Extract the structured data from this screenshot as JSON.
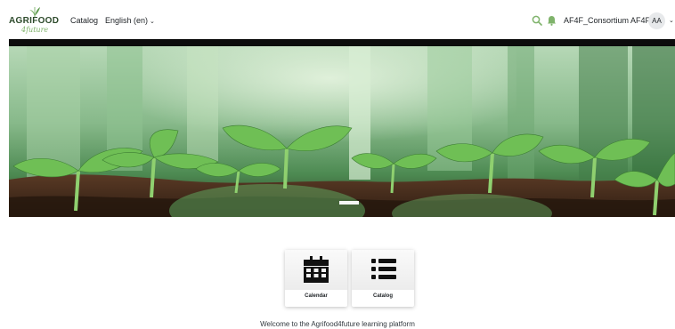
{
  "header": {
    "logo": {
      "brand": "AGRIFOOD",
      "sub": "4future",
      "icon": "leaf-icon"
    },
    "nav": [
      {
        "label": "Catalog"
      },
      {
        "label": "English (en)",
        "icon": "chevron-down-icon"
      }
    ],
    "icons": [
      "search-icon",
      "bell-icon"
    ],
    "user": {
      "name": "AF4F_Consortium AF4F",
      "initials": "AA"
    }
  },
  "banner": {
    "description_icon": "hero-image",
    "active_slide_indicator": "slide-indicator"
  },
  "tiles": [
    {
      "label": "Calendar",
      "icon": "calendar-icon"
    },
    {
      "label": "Catalog",
      "icon": "list-icon"
    }
  ],
  "welcome": {
    "text": "Welcome to the Agrifood4future learning platform"
  },
  "colors": {
    "brand_green": "#7fb36b",
    "text": "#1d2125",
    "accent_icon": "#7fb36b"
  }
}
